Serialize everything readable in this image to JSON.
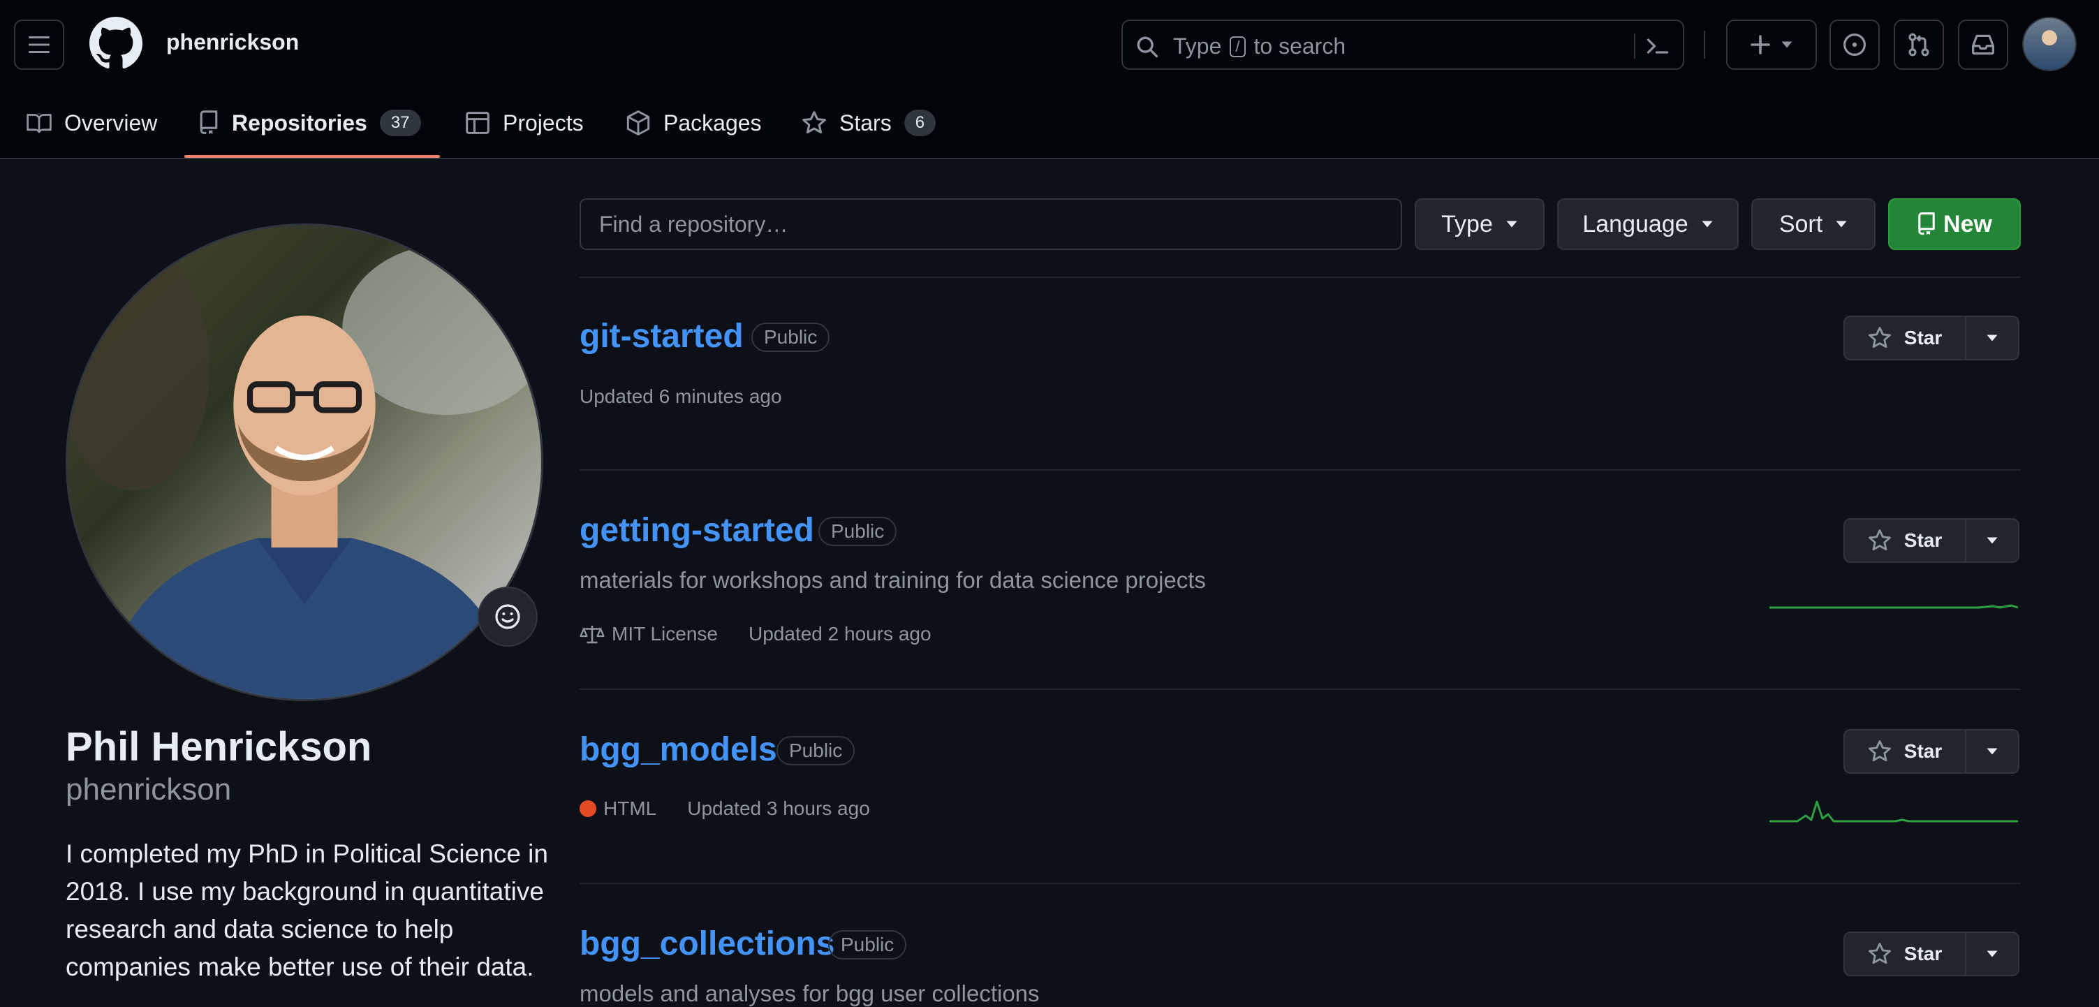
{
  "header": {
    "username": "phenrickson",
    "search": {
      "prefix": "Type",
      "key": "/",
      "suffix": "to search"
    },
    "tabs": [
      {
        "label": "Overview",
        "icon": "book-icon"
      },
      {
        "label": "Repositories",
        "icon": "repo-icon",
        "count": "37",
        "active": true
      },
      {
        "label": "Projects",
        "icon": "table-icon"
      },
      {
        "label": "Packages",
        "icon": "package-icon"
      },
      {
        "label": "Stars",
        "icon": "star-icon",
        "count": "6"
      }
    ]
  },
  "profile": {
    "name": "Phil Henrickson",
    "handle": "phenrickson",
    "bio": "I completed my PhD in Political Science in 2018. I use my background in quantitative research and data science to help companies make better use of their data."
  },
  "filters": {
    "search_placeholder": "Find a repository…",
    "type_label": "Type",
    "language_label": "Language",
    "sort_label": "Sort",
    "new_label": "New"
  },
  "repos": [
    {
      "name": "git-started",
      "visibility": "Public",
      "updated": "Updated 6 minutes ago",
      "star_label": "Star"
    },
    {
      "name": "getting-started",
      "visibility": "Public",
      "description": "materials for workshops and training for data science projects",
      "license": "MIT License",
      "updated": "Updated 2 hours ago",
      "star_label": "Star"
    },
    {
      "name": "bgg_models",
      "visibility": "Public",
      "language": "HTML",
      "language_color": "#e34c26",
      "updated": "Updated 3 hours ago",
      "star_label": "Star"
    },
    {
      "name": "bgg_collections",
      "visibility": "Public",
      "description": "models and analyses for bgg user collections",
      "star_label": "Star"
    }
  ],
  "colors": {
    "background": "#0d1117",
    "header_bg": "#010409",
    "link": "#4493f8",
    "new_button": "#238636",
    "tab_underline": "#f78166",
    "sparkline": "#2ea043"
  }
}
